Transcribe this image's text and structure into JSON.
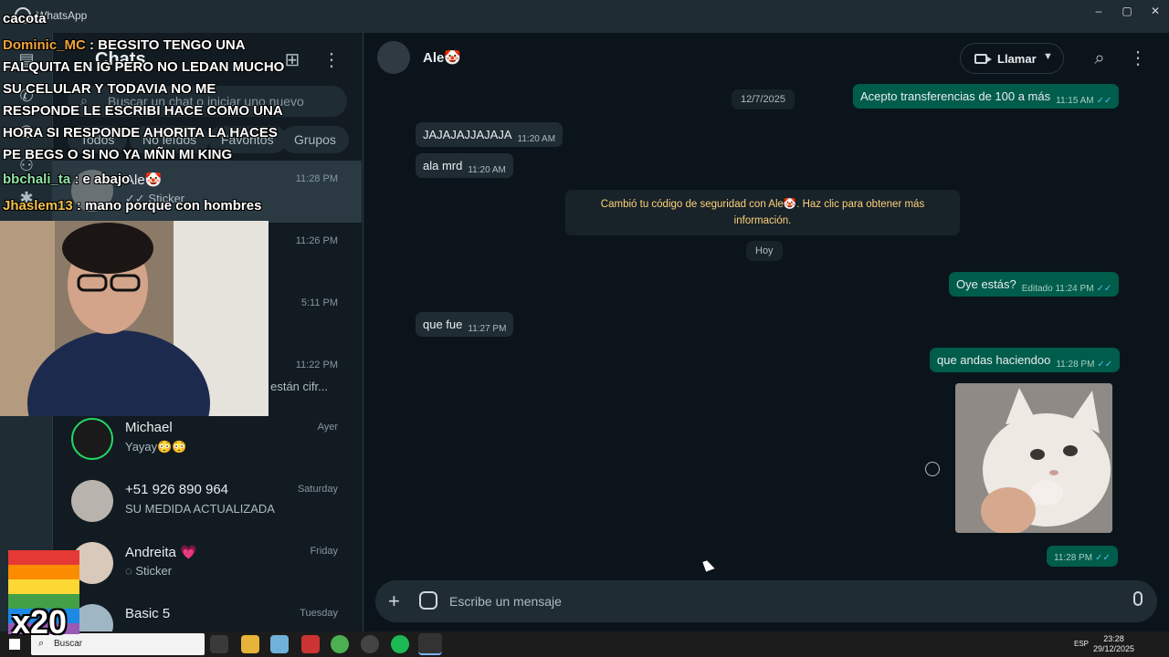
{
  "window": {
    "title": "WhatsApp",
    "controls": [
      "–",
      "▢",
      "✕"
    ]
  },
  "chats_panel": {
    "title": "Chats",
    "search_placeholder": "Buscar un chat o iniciar uno nuevo",
    "filters": [
      "Todos",
      "No leídos",
      "Favoritos",
      "Grupos"
    ],
    "items": [
      {
        "name": "Ale🤡",
        "time": "11:28 PM",
        "preview": "✓✓ Sticker",
        "active": true
      },
      {
        "name": "",
        "time": "11:26 PM",
        "preview": ""
      },
      {
        "name": "",
        "time": "5:11 PM",
        "preview": ""
      },
      {
        "name": "",
        "time": "11:22 PM",
        "preview": "s están cifr..."
      },
      {
        "name": "Michael",
        "time": "Ayer",
        "preview": "Yayay😳😳"
      },
      {
        "name": "+51 926 890 964",
        "time": "Saturday",
        "preview": "SU MEDIDA ACTUALIZADA"
      },
      {
        "name": "Andreita 💗",
        "time": "Friday",
        "preview": "Sticker"
      },
      {
        "name": "Basic 5",
        "time": "Tuesday",
        "preview": ""
      }
    ]
  },
  "chat": {
    "contact_name": "Ale🤡",
    "call_label": "Llamar",
    "composer_placeholder": "Escribe un mensaje",
    "date_chip_1": "12/7/2025",
    "date_chip_2": "Hoy",
    "system_note": "Cambió tu código de seguridad con Ale🤡. Haz clic para obtener más información.",
    "messages": [
      {
        "dir": "out",
        "text": "Acepto transferencias de 100 a más",
        "time": "11:15 AM"
      },
      {
        "dir": "in",
        "text": "JAJAJAJJAJAJA",
        "time": "11:20 AM"
      },
      {
        "dir": "in",
        "text": "ala mrd",
        "time": "11:20 AM"
      },
      {
        "dir": "out",
        "text": "Oye estás?",
        "time": "Editado 11:24 PM"
      },
      {
        "dir": "in",
        "text": "que fue",
        "time": "11:27 PM"
      },
      {
        "dir": "out",
        "text": "que andas haciendoo",
        "time": "11:28 PM"
      },
      {
        "dir": "out",
        "text": "",
        "time": "11:28 PM"
      }
    ]
  },
  "stream_overlay": {
    "chat_lines": [
      {
        "user": "",
        "text": "cacota"
      },
      {
        "user": "Dominic_MC",
        "text": ": BEGSITO TENGO UNA"
      },
      {
        "user": "",
        "text": "FALQUITA EN IG PERO NO LEDAN MUCHO"
      },
      {
        "user": "",
        "text": "SU CELULAR Y TODAVIA NO ME"
      },
      {
        "user": "",
        "text": "RESPONDE LE ESCRIBI HACE COMO UNA"
      },
      {
        "user": "",
        "text": "HORA SI RESPONDE AHORITA LA HACES"
      },
      {
        "user": "",
        "text": "PE BEGS O SI NO YA MÑN MI KING"
      },
      {
        "user": "bbchali_ta",
        "text": ": e abajo"
      },
      {
        "user": "Jhaslem13",
        "text": ": mano porque con hombres"
      }
    ],
    "multiplier": "x20"
  },
  "taskbar": {
    "search_label": "Buscar",
    "lang": "ESP",
    "time": "23:28",
    "date": "29/12/2025"
  },
  "colors": {
    "bubble_out": "#005c4b",
    "bubble_in": "#202c33",
    "background": "#0b141a",
    "accent_read": "#53bdeb",
    "system_note": "#ffd279"
  }
}
